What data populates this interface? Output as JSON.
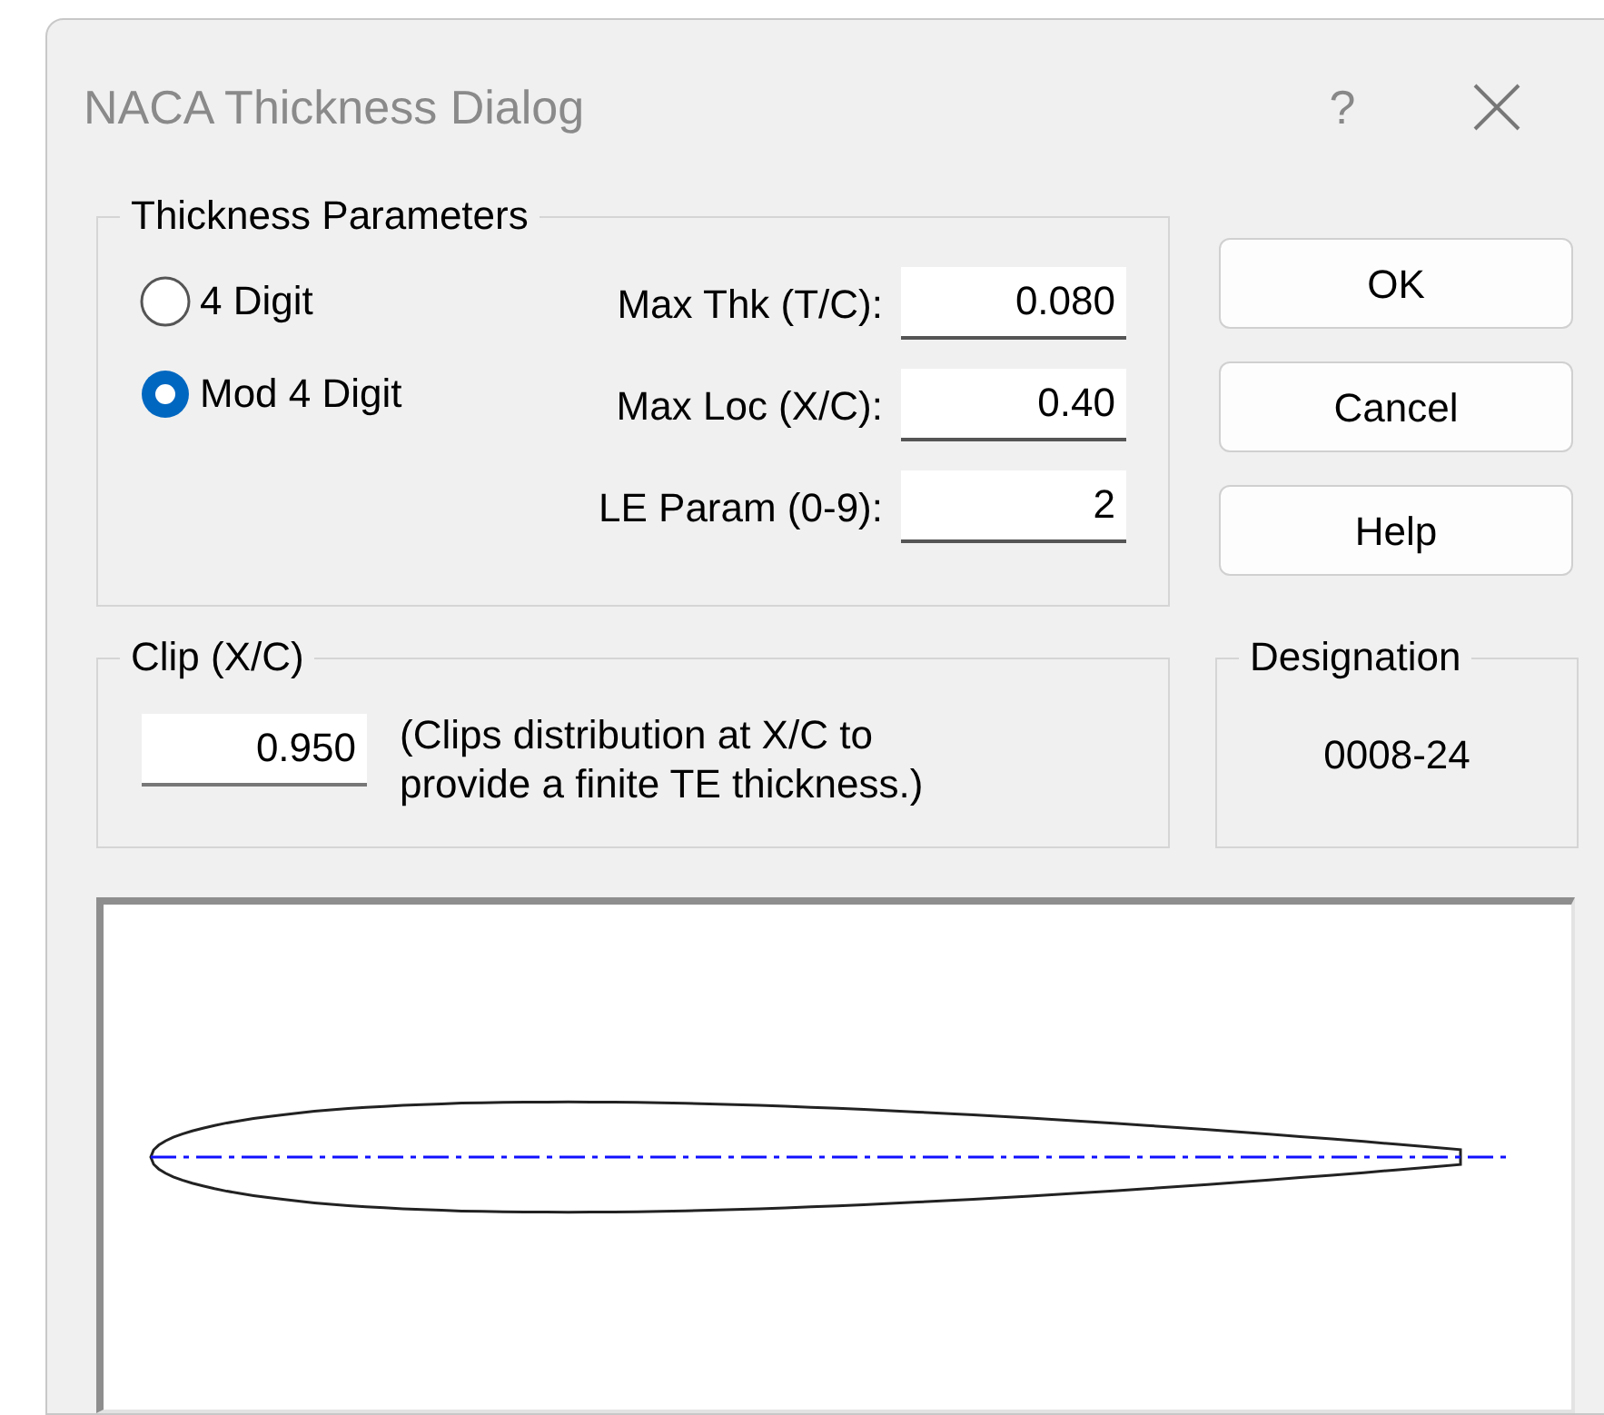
{
  "window": {
    "title": "NACA Thickness Dialog",
    "help_button": "?"
  },
  "thickness_parameters": {
    "title": "Thickness Parameters",
    "options": [
      {
        "label": "4 Digit",
        "selected": false
      },
      {
        "label": "Mod 4 Digit",
        "selected": true
      }
    ],
    "fields": [
      {
        "label": "Max Thk (T/C):",
        "value": "0.080"
      },
      {
        "label": "Max Loc (X/C):",
        "value": "0.40"
      },
      {
        "label": "LE Param (0-9):",
        "value": "2"
      }
    ]
  },
  "buttons": [
    "OK",
    "Cancel",
    "Help"
  ],
  "clip": {
    "title": "Clip (X/C)",
    "value": "0.950",
    "note": "(Clips distribution at X/C to provide a finite TE thickness.)"
  },
  "designation": {
    "title": "Designation",
    "value": "0008-24"
  }
}
